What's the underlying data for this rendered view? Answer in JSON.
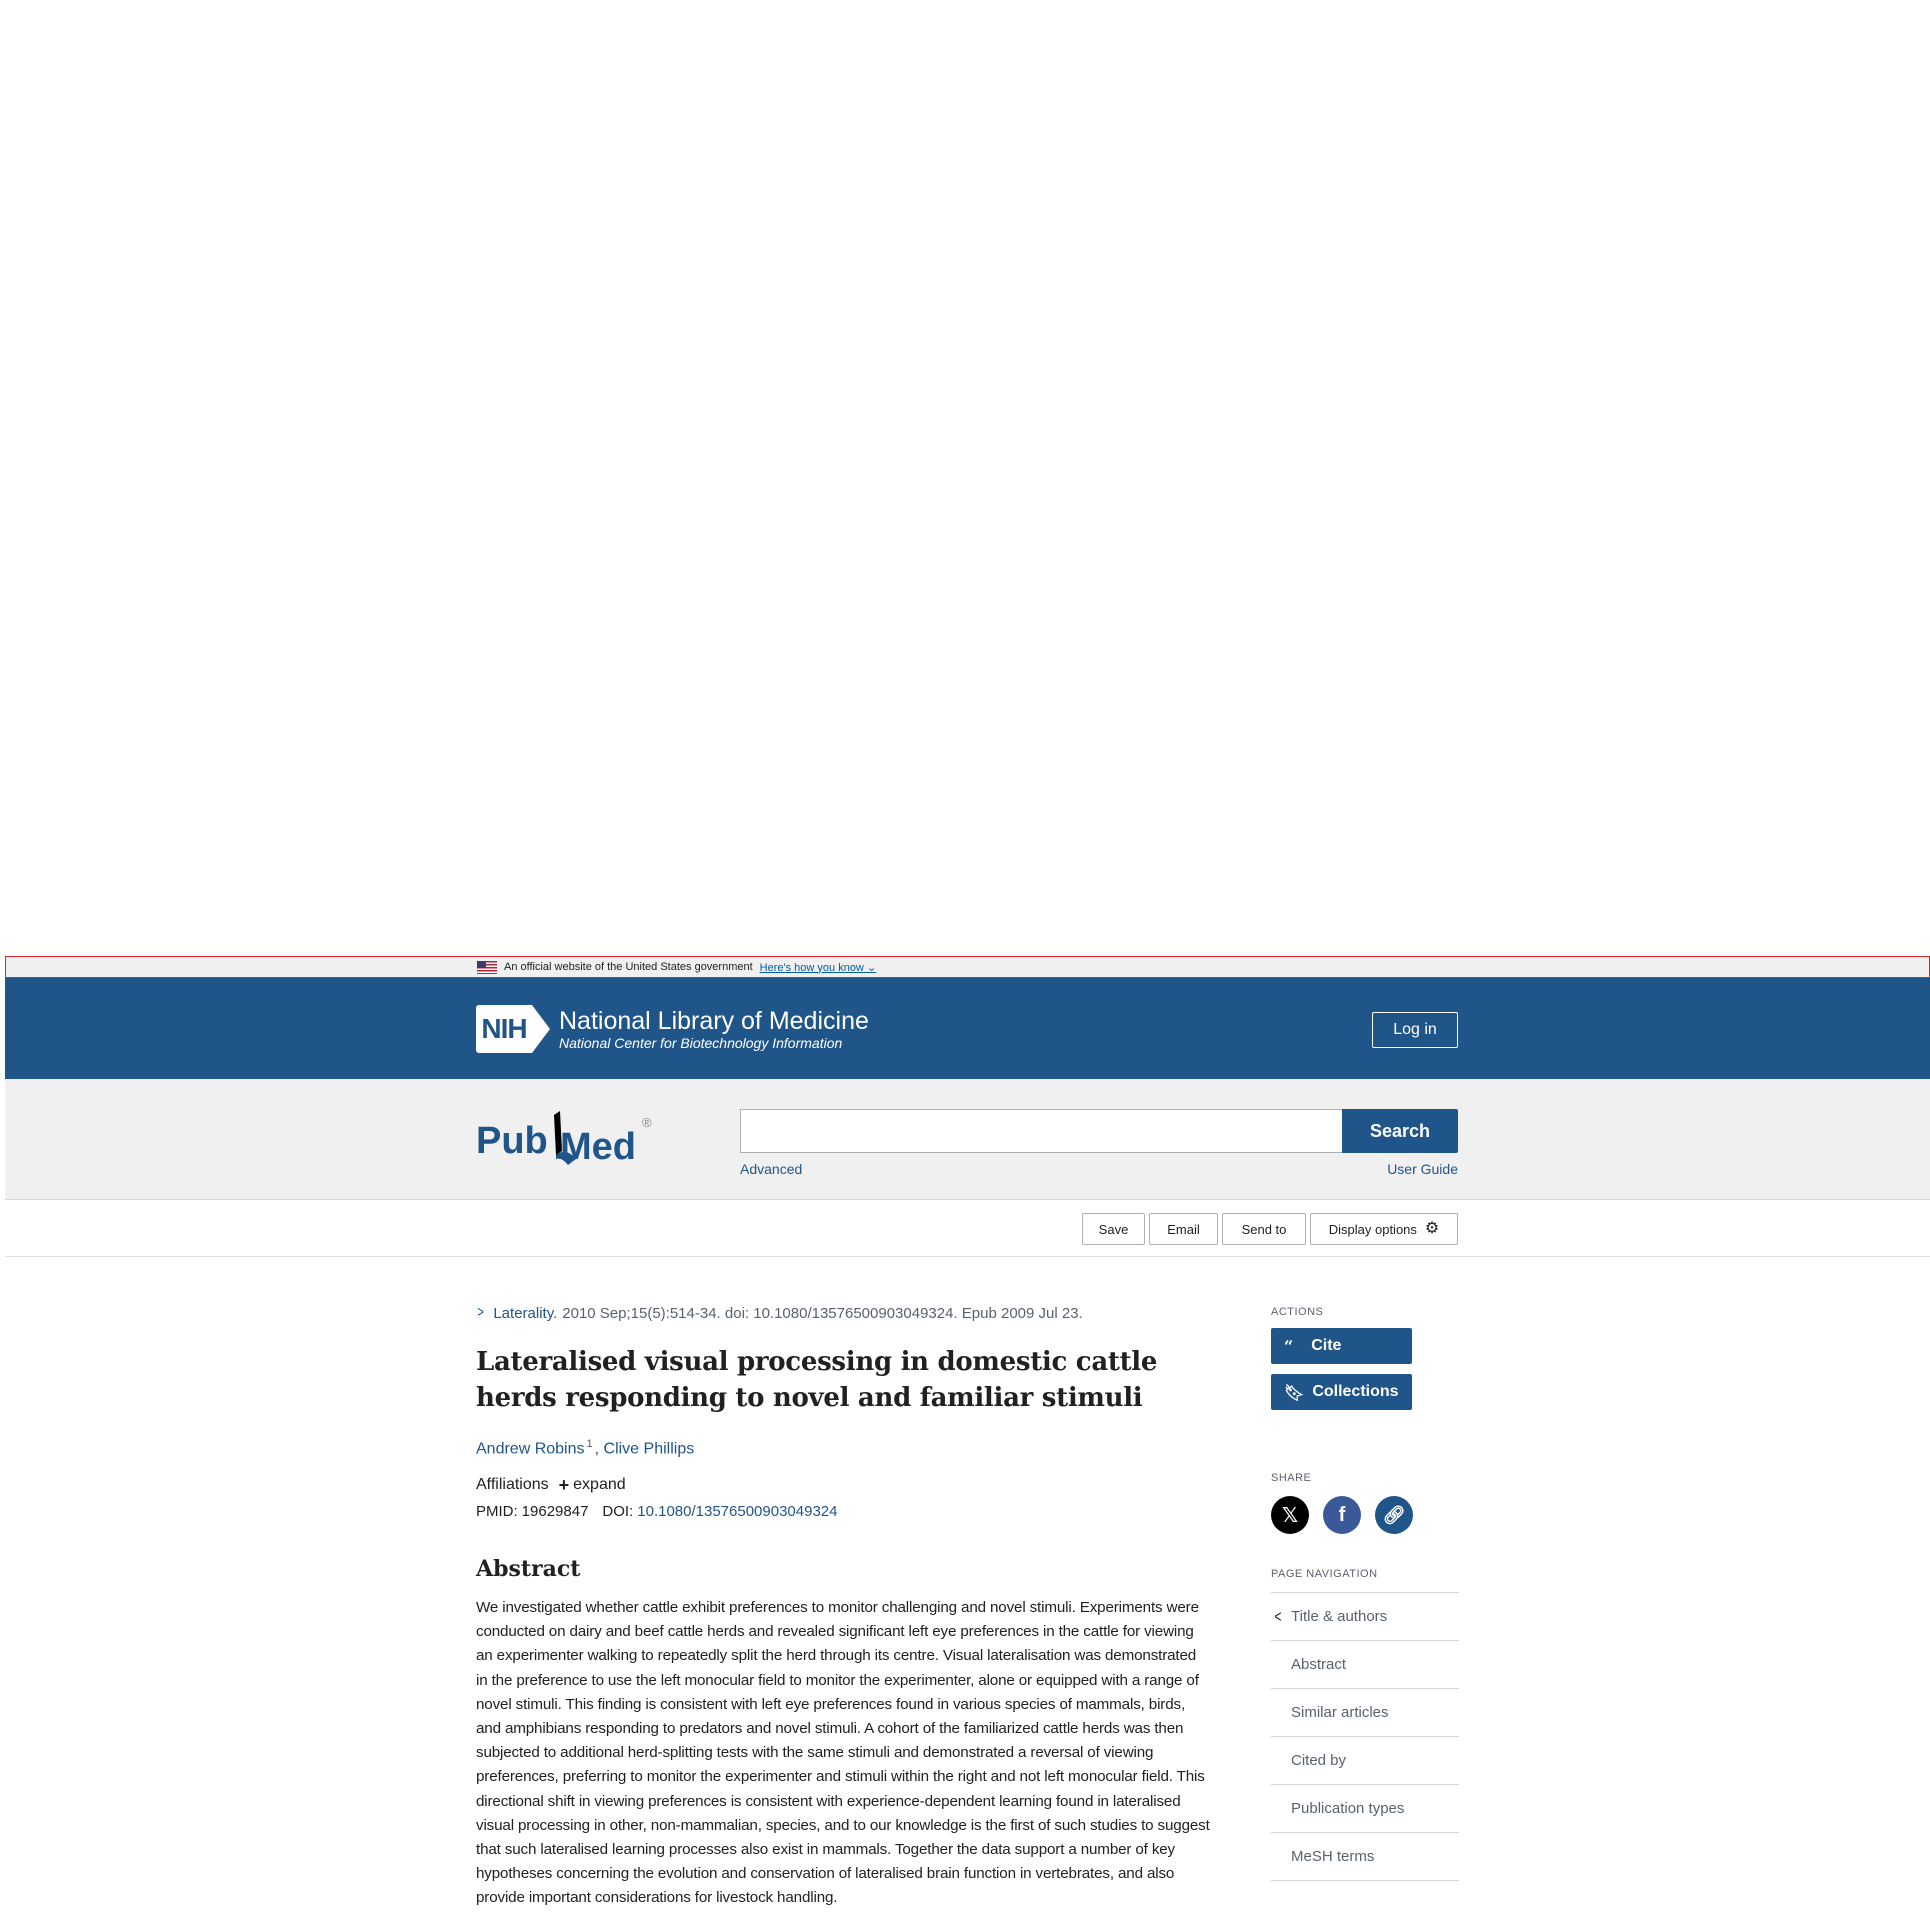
{
  "gov_banner": {
    "text": "An official website of the United States government",
    "link": "Here's how you know"
  },
  "header": {
    "nih_badge": "NIH",
    "org_title": "National Library of Medicine",
    "org_subtitle": "National Center for Biotechnology Information",
    "login": "Log in"
  },
  "search": {
    "logo_text_left": "Pub",
    "logo_text_right": "Med",
    "registered": "®",
    "query": "",
    "button": "Search",
    "advanced": "Advanced",
    "user_guide": "User Guide"
  },
  "actions_bar": {
    "save": "Save",
    "email": "Email",
    "send_to": "Send to",
    "display_options": "Display options"
  },
  "article": {
    "journal": "Laterality.",
    "citation": "2010 Sep;15(5):514-34. doi: 10.1080/13576500903049324. Epub 2009 Jul 23.",
    "title": "Lateralised visual processing in domestic cattle herds responding to novel and familiar stimuli",
    "author1": "Andrew Robins",
    "author1_sup": "1",
    "author2": "Clive Phillips",
    "affiliations": "Affiliations",
    "expand": "expand",
    "pmid_label": "PMID:",
    "pmid": "19629847",
    "doi_label": "DOI:",
    "doi": "10.1080/13576500903049324",
    "abstract_heading": "Abstract",
    "abstract": "We investigated whether cattle exhibit preferences to monitor challenging and novel stimuli. Experiments were conducted on dairy and beef cattle herds and revealed significant left eye preferences in the cattle for viewing an experimenter walking to repeatedly split the herd through its centre. Visual lateralisation was demonstrated in the preference to use the left monocular field to monitor the experimenter, alone or equipped with a range of novel stimuli. This finding is consistent with left eye preferences found in various species of mammals, birds, and amphibians responding to predators and novel stimuli. A cohort of the familiarized cattle herds was then subjected to additional herd-splitting tests with the same stimuli and demonstrated a reversal of viewing preferences, preferring to monitor the experimenter and stimuli within the right and not left monocular field. This directional shift in viewing preferences is consistent with experience-dependent learning found in lateralised visual processing in other, non-mammalian, species, and to our knowledge is the first of such studies to suggest that such lateralised learning processes also exist in mammals. Together the data support a number of key hypotheses concerning the evolution and conservation of lateralised brain function in vertebrates, and also provide important considerations for livestock handling."
  },
  "sidebar": {
    "actions_heading": "ACTIONS",
    "cite": "Cite",
    "collections": "Collections",
    "share_heading": "SHARE",
    "page_nav_heading": "PAGE NAVIGATION",
    "nav": [
      "Title & authors",
      "Abstract",
      "Similar articles",
      "Cited by",
      "Publication types",
      "MeSH terms"
    ]
  },
  "colors": {
    "nih_blue": "#20558a",
    "link_blue": "#20558a",
    "band_gray": "#f0f0f0",
    "facebook": "#3b5998",
    "x_black": "#000000",
    "link_circle": "#20558a"
  }
}
